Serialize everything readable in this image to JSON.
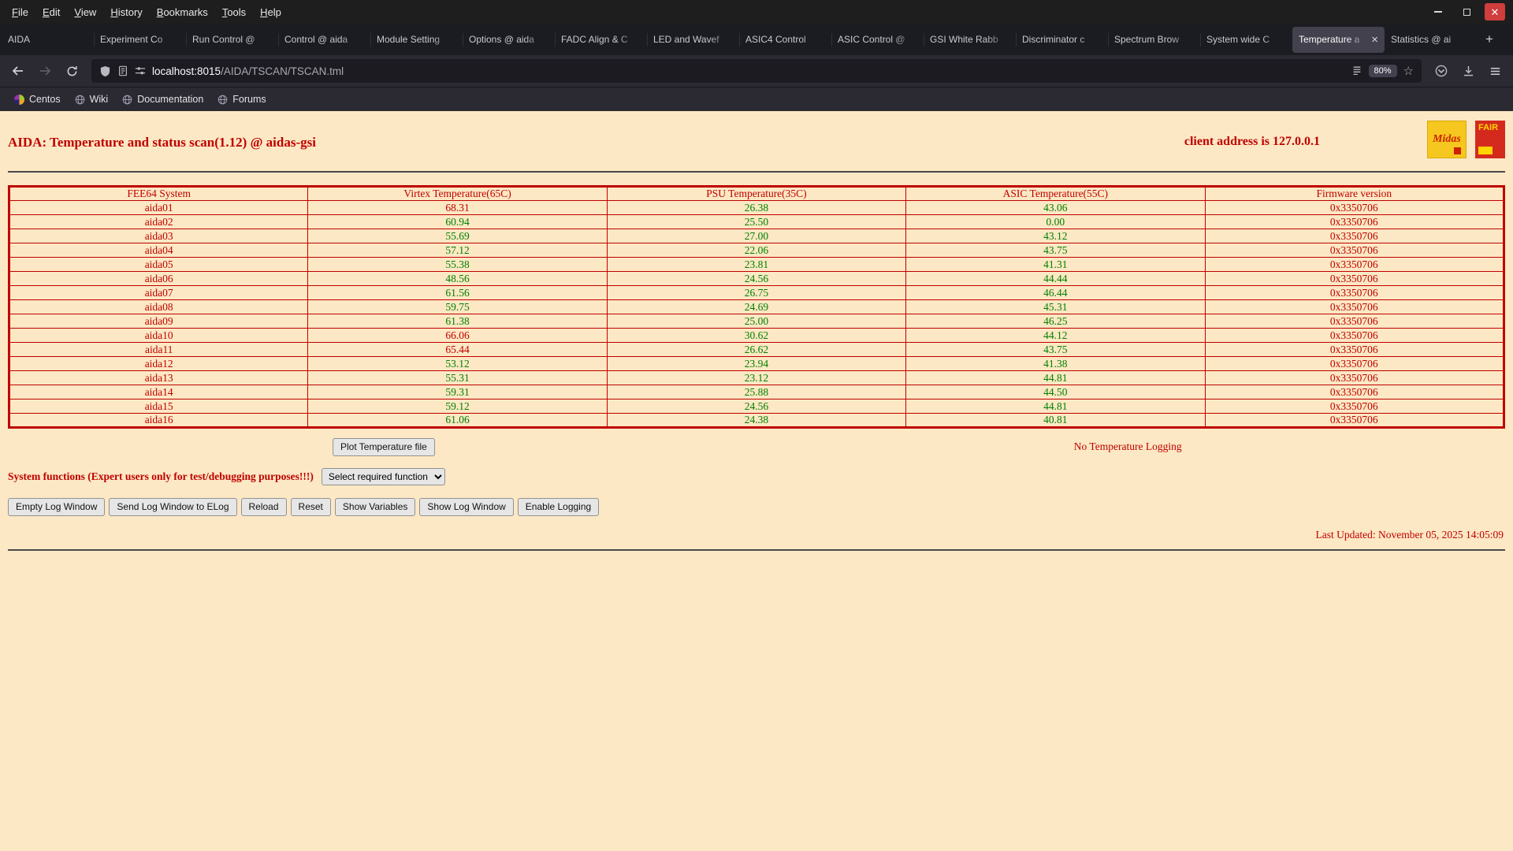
{
  "browser": {
    "menu_items": [
      "File",
      "Edit",
      "View",
      "History",
      "Bookmarks",
      "Tools",
      "Help"
    ],
    "tabs": [
      {
        "label": "AIDA",
        "active": false
      },
      {
        "label": "Experiment Co",
        "active": false
      },
      {
        "label": "Run Control @",
        "active": false
      },
      {
        "label": "Control @ aida",
        "active": false
      },
      {
        "label": "Module Setting",
        "active": false
      },
      {
        "label": "Options @ aida",
        "active": false
      },
      {
        "label": "FADC Align & C",
        "active": false
      },
      {
        "label": "LED and Wavef",
        "active": false
      },
      {
        "label": "ASIC4 Control",
        "active": false
      },
      {
        "label": "ASIC Control @",
        "active": false
      },
      {
        "label": "GSI White Rabb",
        "active": false
      },
      {
        "label": "Discriminator c",
        "active": false
      },
      {
        "label": "Spectrum Brow",
        "active": false
      },
      {
        "label": "System wide C",
        "active": false
      },
      {
        "label": "Temperature a",
        "active": true
      },
      {
        "label": "Statistics @ ai",
        "active": false
      }
    ],
    "new_tab_label": "+",
    "url_host": "localhost:8015",
    "url_path": "/AIDA/TSCAN/TSCAN.tml",
    "zoom": "80%",
    "bookmarks": [
      {
        "label": "Centos",
        "icon": "centos"
      },
      {
        "label": "Wiki",
        "icon": "globe"
      },
      {
        "label": "Documentation",
        "icon": "globe"
      },
      {
        "label": "Forums",
        "icon": "globe"
      }
    ]
  },
  "page": {
    "title": "AIDA: Temperature and status scan(1.12) @ aidas-gsi",
    "client_address": "client address is 127.0.0.1",
    "logos": [
      {
        "name": "midas",
        "text": "Midas"
      },
      {
        "name": "fair",
        "text": "FAIR"
      }
    ],
    "table": {
      "headers": [
        "FEE64 System",
        "Virtex Temperature(65C)",
        "PSU Temperature(35C)",
        "ASIC Temperature(55C)",
        "Firmware version"
      ],
      "thresholds": {
        "virtex": 65,
        "psu": 35,
        "asic": 55
      },
      "rows": [
        {
          "name": "aida01",
          "virtex": "68.31",
          "psu": "26.38",
          "asic": "43.06",
          "firmware": "0x3350706"
        },
        {
          "name": "aida02",
          "virtex": "60.94",
          "psu": "25.50",
          "asic": "0.00",
          "firmware": "0x3350706"
        },
        {
          "name": "aida03",
          "virtex": "55.69",
          "psu": "27.00",
          "asic": "43.12",
          "firmware": "0x3350706"
        },
        {
          "name": "aida04",
          "virtex": "57.12",
          "psu": "22.06",
          "asic": "43.75",
          "firmware": "0x3350706"
        },
        {
          "name": "aida05",
          "virtex": "55.38",
          "psu": "23.81",
          "asic": "41.31",
          "firmware": "0x3350706"
        },
        {
          "name": "aida06",
          "virtex": "48.56",
          "psu": "24.56",
          "asic": "44.44",
          "firmware": "0x3350706"
        },
        {
          "name": "aida07",
          "virtex": "61.56",
          "psu": "26.75",
          "asic": "46.44",
          "firmware": "0x3350706"
        },
        {
          "name": "aida08",
          "virtex": "59.75",
          "psu": "24.69",
          "asic": "45.31",
          "firmware": "0x3350706"
        },
        {
          "name": "aida09",
          "virtex": "61.38",
          "psu": "25.00",
          "asic": "46.25",
          "firmware": "0x3350706"
        },
        {
          "name": "aida10",
          "virtex": "66.06",
          "psu": "30.62",
          "asic": "44.12",
          "firmware": "0x3350706"
        },
        {
          "name": "aida11",
          "virtex": "65.44",
          "psu": "26.62",
          "asic": "43.75",
          "firmware": "0x3350706"
        },
        {
          "name": "aida12",
          "virtex": "53.12",
          "psu": "23.94",
          "asic": "41.38",
          "firmware": "0x3350706"
        },
        {
          "name": "aida13",
          "virtex": "55.31",
          "psu": "23.12",
          "asic": "44.81",
          "firmware": "0x3350706"
        },
        {
          "name": "aida14",
          "virtex": "59.31",
          "psu": "25.88",
          "asic": "44.50",
          "firmware": "0x3350706"
        },
        {
          "name": "aida15",
          "virtex": "59.12",
          "psu": "24.56",
          "asic": "44.81",
          "firmware": "0x3350706"
        },
        {
          "name": "aida16",
          "virtex": "61.06",
          "psu": "24.38",
          "asic": "40.81",
          "firmware": "0x3350706"
        }
      ]
    },
    "plot_button": "Plot Temperature file",
    "logging_status": "No Temperature Logging",
    "system_functions_label": "System functions (Expert users only for test/debugging purposes!!!)",
    "select_placeholder": "Select required function",
    "action_buttons": [
      "Empty Log Window",
      "Send Log Window to ELog",
      "Reload",
      "Reset",
      "Show Variables",
      "Show Log Window",
      "Enable Logging"
    ],
    "last_updated": "Last Updated: November 05, 2025 14:05:09",
    "colors": {
      "accent_red": "#c00000",
      "ok_green": "#008000",
      "page_bg": "#fce8c4"
    }
  }
}
